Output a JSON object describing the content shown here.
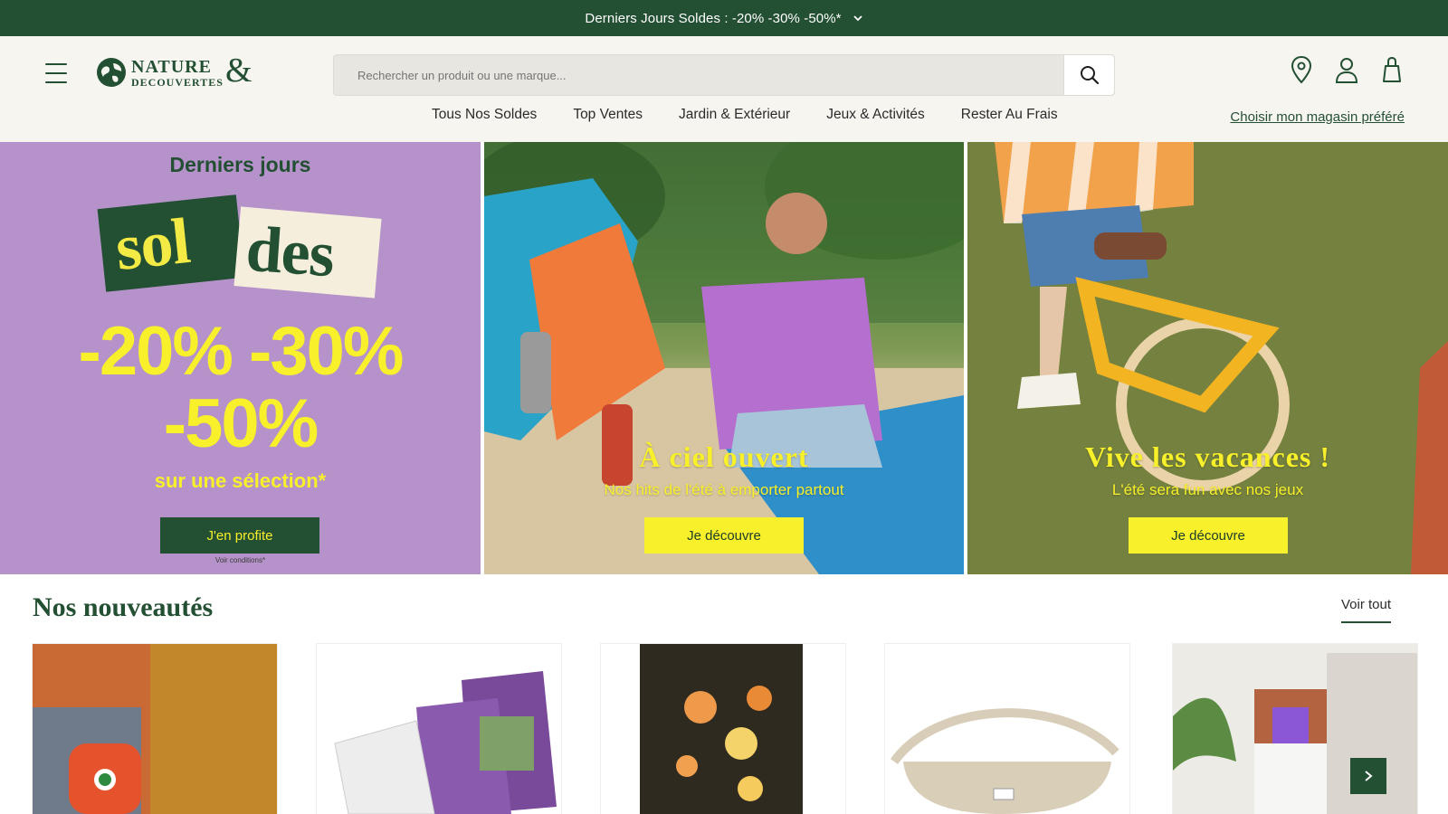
{
  "promo": {
    "text": "Derniers Jours Soldes : -20% -30% -50%*"
  },
  "header": {
    "logo_line1": "NATURE",
    "logo_line2": "DECOUVERTES",
    "logo_amp": "&",
    "search_placeholder": "Rechercher un produit ou une marque...",
    "nav": [
      "Tous Nos Soldes",
      "Top Ventes",
      "Jardin & Extérieur",
      "Jeux & Activités",
      "Rester Au Frais"
    ],
    "store_link": "Choisir mon magasin préféré"
  },
  "hero": {
    "soldes": {
      "kicker": "Derniers jours",
      "word_a": "sol",
      "word_b": "des",
      "pct_line1": "-20% -30%",
      "pct_line2": "-50%",
      "selection": "sur une sélection*",
      "button": "J'en profite",
      "conditions": "Voir conditions*"
    },
    "ciel": {
      "title": "À ciel ouvert",
      "subtitle": "Nos hits de l'été à emporter partout",
      "button": "Je découvre"
    },
    "vacances": {
      "title": "Vive les vacances !",
      "subtitle": "L'été sera fun avec nos jeux",
      "button": "Je découvre"
    }
  },
  "section": {
    "title": "Nos nouveautés",
    "see_all": "Voir tout"
  },
  "products": [
    {
      "name": "portable-speaker"
    },
    {
      "name": "recto-verso-guide"
    },
    {
      "name": "solar-flower-lights"
    },
    {
      "name": "belt-bag"
    },
    {
      "name": "mosquito-lamp"
    }
  ],
  "colors": {
    "brand_green": "#234f33",
    "accent_yellow": "#f7f02a",
    "soldes_purple": "#b592c9",
    "header_bg": "#f7f5f0"
  }
}
